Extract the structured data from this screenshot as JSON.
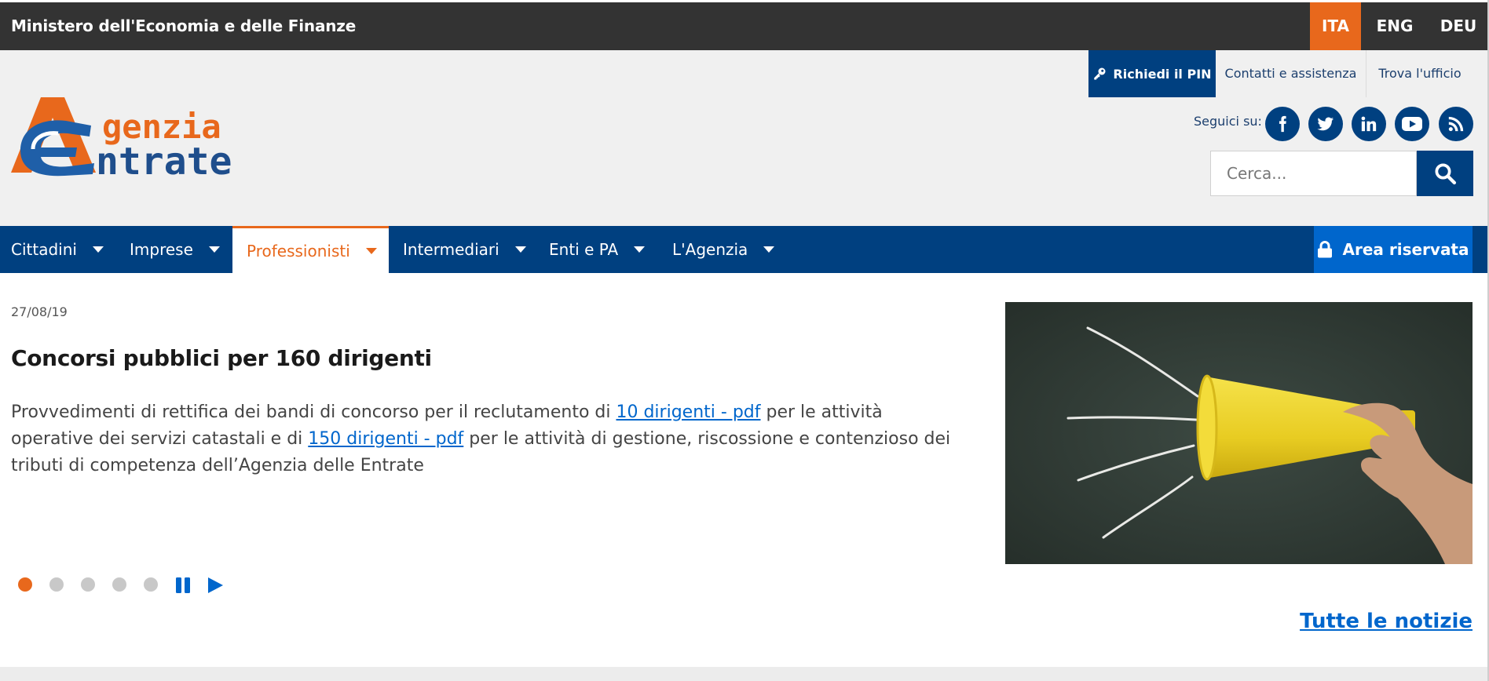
{
  "topbar": {
    "ministry": "Ministero dell'Economia e delle Finanze",
    "languages": [
      "ITA",
      "ENG",
      "DEU"
    ],
    "active_language": "ITA"
  },
  "header": {
    "pin_label": "Richiedi il PIN",
    "contacts_label": "Contatti e assistenza",
    "office_label": "Trova l'ufficio",
    "follow_label": "Seguici su:",
    "social_icons": [
      "facebook-icon",
      "twitter-icon",
      "linkedin-icon",
      "youtube-icon",
      "rss-icon"
    ],
    "search_placeholder": "Cerca..."
  },
  "logo": {
    "line1": "genzia",
    "line2": "ntrate"
  },
  "nav": {
    "items": [
      {
        "label": "Cittadini"
      },
      {
        "label": "Imprese"
      },
      {
        "label": "Professionisti"
      },
      {
        "label": "Intermediari"
      },
      {
        "label": "Enti e PA"
      },
      {
        "label": "L'Agenzia"
      }
    ],
    "active": "Professionisti",
    "area_label": "Area riservata"
  },
  "news": {
    "date": "27/08/19",
    "title": "Concorsi pubblici per 160 dirigenti",
    "body_part1": "Provvedimenti di rettifica dei bandi di concorso per il reclutamento di ",
    "link1": "10 dirigenti - pdf",
    "body_part2": " per le attività operative dei servizi catastali e di ",
    "link2": "150 dirigenti - pdf",
    "body_part3": " per le attività di gestione, riscossione e contenzioso dei tributi di competenza dell’Agenzia delle Entrate"
  },
  "carousel": {
    "slides": 5,
    "active_slide": 1
  },
  "all_news_label": "Tutte le notizie",
  "colors": {
    "brand_blue": "#004080",
    "accent_orange": "#e8681c",
    "link_blue": "#0066cc",
    "topbar": "#333333"
  }
}
